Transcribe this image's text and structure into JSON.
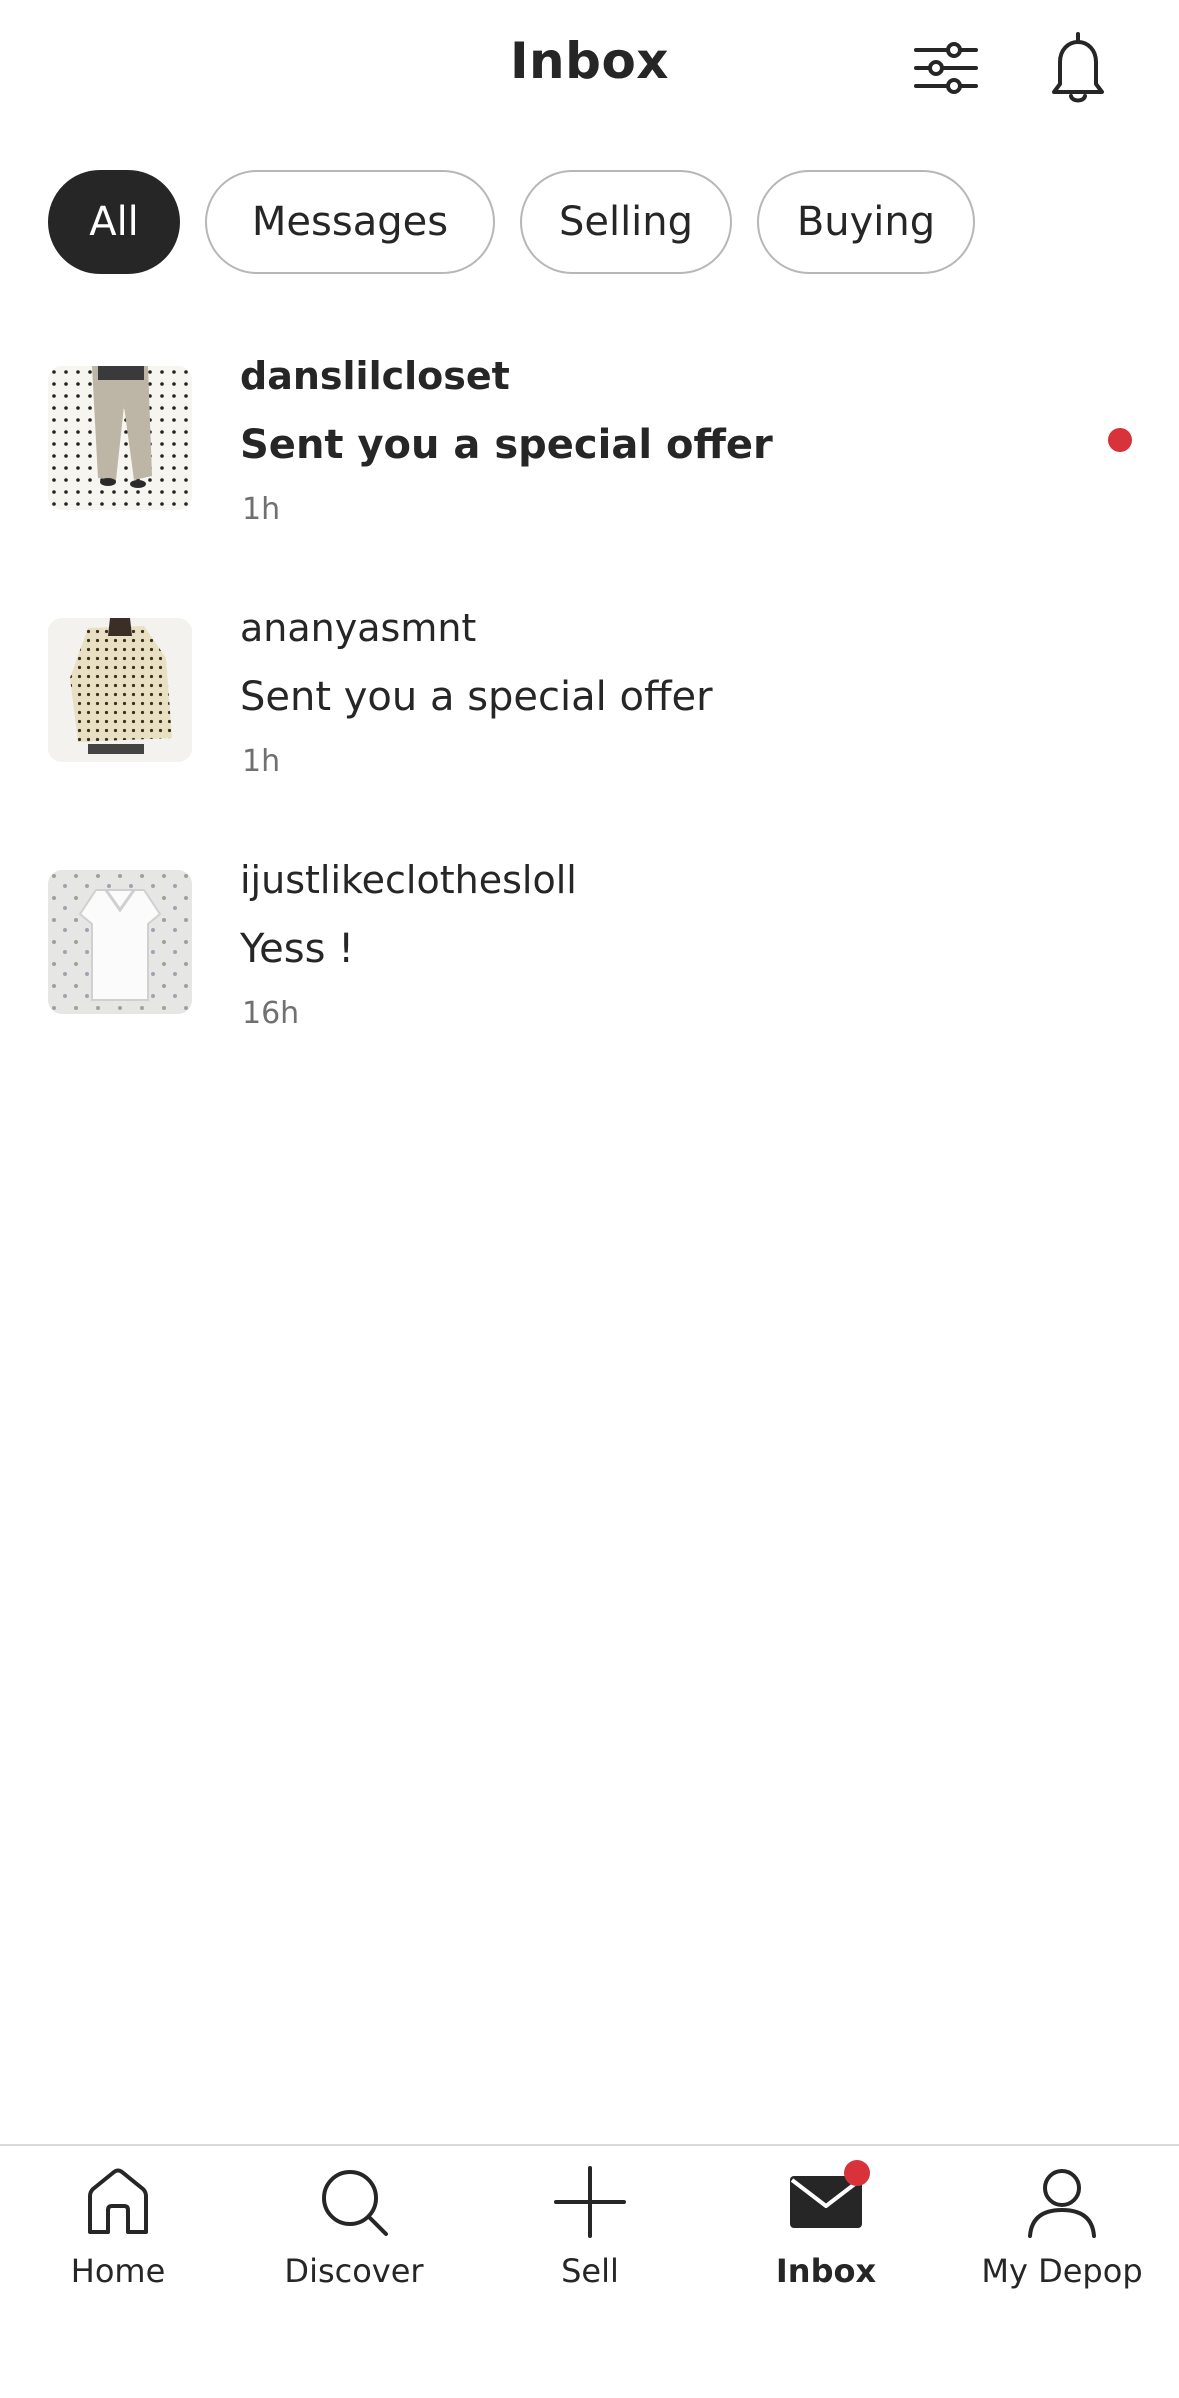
{
  "header": {
    "title": "Inbox",
    "filter_icon": "sliders-icon",
    "notifications_icon": "bell-icon"
  },
  "filters": [
    {
      "label": "All",
      "active": true
    },
    {
      "label": "Messages",
      "active": false
    },
    {
      "label": "Selling",
      "active": false
    },
    {
      "label": "Buying",
      "active": false
    }
  ],
  "conversations": [
    {
      "username": "danslilcloset",
      "message": "Sent you a special offer",
      "time": "1h",
      "unread": true
    },
    {
      "username": "ananyasmnt",
      "message": "Sent you a special offer",
      "time": "1h",
      "unread": false
    },
    {
      "username": "ijustlikeclothesloll",
      "message": "Yess !",
      "time": "16h",
      "unread": false
    }
  ],
  "tabbar": [
    {
      "label": "Home",
      "icon": "home-icon",
      "active": false
    },
    {
      "label": "Discover",
      "icon": "search-icon",
      "active": false
    },
    {
      "label": "Sell",
      "icon": "plus-icon",
      "active": false
    },
    {
      "label": "Inbox",
      "icon": "mail-icon",
      "active": true,
      "badge": true
    },
    {
      "label": "My Depop",
      "icon": "profile-icon",
      "active": false
    }
  ],
  "colors": {
    "text": "#262626",
    "accent_red": "#d8323a",
    "chip_border": "#b7b7b7",
    "secondary_text": "#707070"
  }
}
